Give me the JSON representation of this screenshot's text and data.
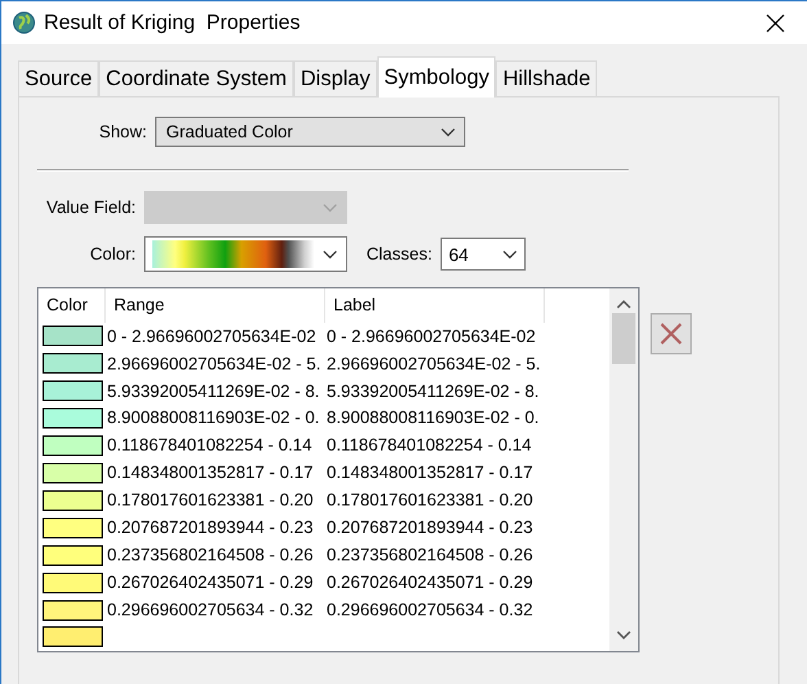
{
  "window": {
    "title": "Result of Kriging  Properties"
  },
  "tabs": [
    {
      "label": "Source",
      "selected": false
    },
    {
      "label": "Coordinate System",
      "selected": false
    },
    {
      "label": "Display",
      "selected": false
    },
    {
      "label": "Symbology",
      "selected": true
    },
    {
      "label": "Hillshade",
      "selected": false
    }
  ],
  "show": {
    "label": "Show:",
    "value": "Graduated Color"
  },
  "value_field": {
    "label": "Value Field:",
    "disabled": true
  },
  "color": {
    "label": "Color:"
  },
  "classes": {
    "label": "Classes:",
    "value": "64"
  },
  "table": {
    "columns": [
      "Color",
      "Range",
      "Label"
    ],
    "rows": [
      {
        "color": "#a6e3c8",
        "range": "0 - 2.96696002705634E-02",
        "label": "0 - 2.96696002705634E-02"
      },
      {
        "color": "#a8ecd0",
        "range": "2.96696002705634E-02 - 5.",
        "label": "2.96696002705634E-02 - 5."
      },
      {
        "color": "#a8f2d8",
        "range": "5.93392005411269E-02 - 8.",
        "label": "5.93392005411269E-02 - 8."
      },
      {
        "color": "#aafcdc",
        "range": "8.90088008116903E-02 - 0.",
        "label": "8.90088008116903E-02 - 0."
      },
      {
        "color": "#c0ffc0",
        "range": "0.118678401082254 - 0.14",
        "label": "0.118678401082254 - 0.14"
      },
      {
        "color": "#d8ffa8",
        "range": "0.148348001352817 - 0.17",
        "label": "0.148348001352817 - 0.17"
      },
      {
        "color": "#ecff90",
        "range": "0.178017601623381 - 0.20",
        "label": "0.178017601623381 - 0.20"
      },
      {
        "color": "#ffff80",
        "range": "0.207687201893944 - 0.23",
        "label": "0.207687201893944 - 0.23"
      },
      {
        "color": "#ffff7c",
        "range": "0.237356802164508 - 0.26",
        "label": "0.237356802164508 - 0.26"
      },
      {
        "color": "#fffa78",
        "range": "0.267026402435071 - 0.29",
        "label": "0.267026402435071 - 0.29"
      },
      {
        "color": "#fff47c",
        "range": "0.296696002705634 - 0.32",
        "label": "0.296696002705634 - 0.32"
      },
      {
        "color": "#ffee70"
      }
    ]
  }
}
